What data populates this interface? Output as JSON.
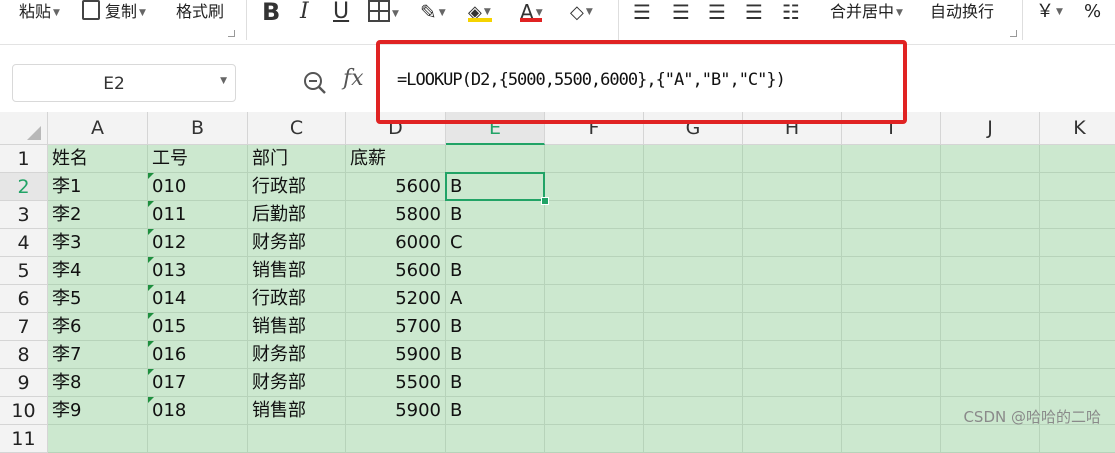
{
  "ribbon": {
    "paste_label": "粘贴",
    "copy_label": "复制",
    "format_painter_label": "格式刷",
    "bold_label": "B",
    "italic_label": "I",
    "underline_label": "U",
    "font_color_letter": "A",
    "merge_center_label": "合并居中",
    "wrap_text_label": "自动换行",
    "currency_label": "￥",
    "percent_label": "%",
    "accent_colors": {
      "font_color_bar": "#e02323",
      "fill_color_bar": "#f5d300"
    }
  },
  "formula_bar": {
    "name_box": "E2",
    "fx_label": "fx",
    "formula": "=LOOKUP(D2,{5000,5500,6000},{\"A\",\"B\",\"C\"})"
  },
  "grid": {
    "columns": [
      "A",
      "B",
      "C",
      "D",
      "E",
      "F",
      "G",
      "H",
      "I",
      "J",
      "K"
    ],
    "active_column": "E",
    "row_numbers": [
      "1",
      "2",
      "3",
      "4",
      "5",
      "6",
      "7",
      "8",
      "9",
      "10",
      "11"
    ],
    "active_row": "2",
    "header_row": {
      "A": "姓名",
      "B": "工号",
      "C": "部门",
      "D": "底薪",
      "E": ""
    },
    "rows": [
      {
        "A": "李1",
        "B": "010",
        "C": "行政部",
        "D": "5600",
        "E": "B"
      },
      {
        "A": "李2",
        "B": "011",
        "C": "后勤部",
        "D": "5800",
        "E": "B"
      },
      {
        "A": "李3",
        "B": "012",
        "C": "财务部",
        "D": "6000",
        "E": "C"
      },
      {
        "A": "李4",
        "B": "013",
        "C": "销售部",
        "D": "5600",
        "E": "B"
      },
      {
        "A": "李5",
        "B": "014",
        "C": "行政部",
        "D": "5200",
        "E": "A"
      },
      {
        "A": "李6",
        "B": "015",
        "C": "销售部",
        "D": "5700",
        "E": "B"
      },
      {
        "A": "李7",
        "B": "016",
        "C": "财务部",
        "D": "5900",
        "E": "B"
      },
      {
        "A": "李8",
        "B": "017",
        "C": "财务部",
        "D": "5500",
        "E": "B"
      },
      {
        "A": "李9",
        "B": "018",
        "C": "销售部",
        "D": "5900",
        "E": "B"
      }
    ],
    "colors": {
      "eye_protection_bg": "#cce8cf",
      "selection": "#21a366"
    }
  },
  "watermark": "CSDN @哈哈的二哈"
}
